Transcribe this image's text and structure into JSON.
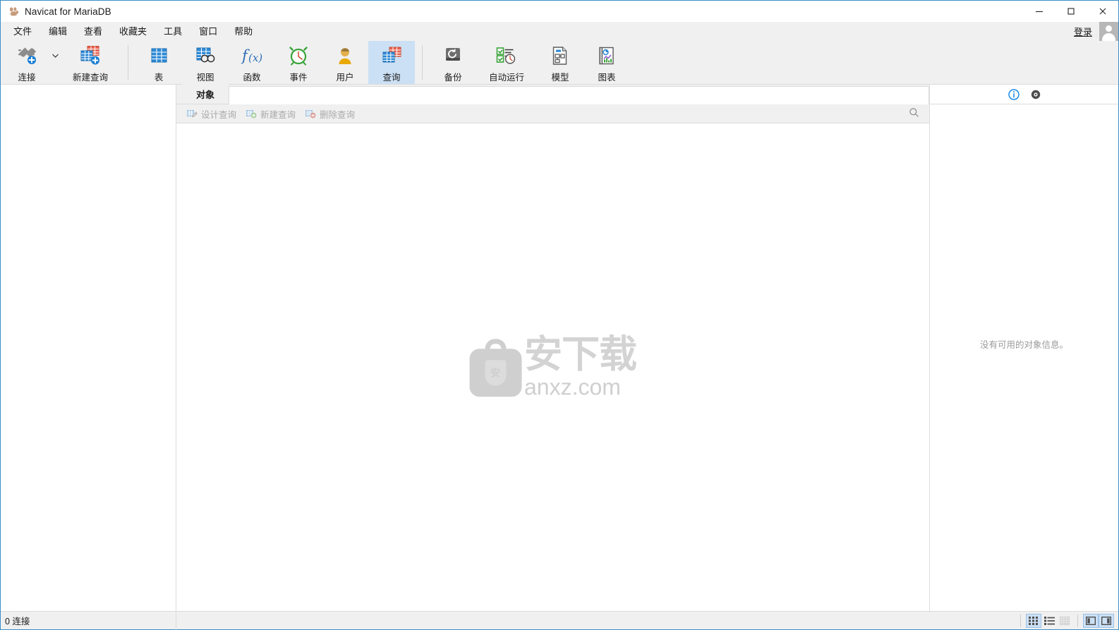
{
  "window": {
    "title": "Navicat for MariaDB",
    "logo_icon": "navicat-paw-logo",
    "minimize_label": "—",
    "maximize_label": "□",
    "close_label": "✕"
  },
  "menubar": {
    "items": [
      {
        "label": "文件"
      },
      {
        "label": "编辑"
      },
      {
        "label": "查看"
      },
      {
        "label": "收藏夹"
      },
      {
        "label": "工具"
      },
      {
        "label": "窗口"
      },
      {
        "label": "帮助"
      }
    ],
    "login_label": "登录",
    "avatar_icon": "user-avatar-icon"
  },
  "toolbar": {
    "items": [
      {
        "label": "连接",
        "icon": "connection-plug-add-icon",
        "active": false,
        "has_caret": true
      },
      {
        "label": "新建查询",
        "icon": "new-query-add-icon",
        "active": false,
        "has_caret": false
      },
      {
        "label": "表",
        "icon": "table-grid-icon",
        "active": false,
        "has_caret": false
      },
      {
        "label": "视图",
        "icon": "view-icon",
        "active": false,
        "has_caret": false
      },
      {
        "label": "函数",
        "icon": "function-fx-icon",
        "active": false,
        "has_caret": false
      },
      {
        "label": "事件",
        "icon": "event-clock-icon",
        "active": false,
        "has_caret": false
      },
      {
        "label": "用户",
        "icon": "user-person-icon",
        "active": false,
        "has_caret": false
      },
      {
        "label": "查询",
        "icon": "query-tables-icon",
        "active": true,
        "has_caret": false
      },
      {
        "label": "备份",
        "icon": "backup-restore-icon",
        "active": false,
        "has_caret": false
      },
      {
        "label": "自动运行",
        "icon": "automation-schedule-icon",
        "active": false,
        "has_caret": false
      },
      {
        "label": "模型",
        "icon": "model-diagram-icon",
        "active": false,
        "has_caret": false
      },
      {
        "label": "图表",
        "icon": "chart-report-icon",
        "active": false,
        "has_caret": false
      }
    ]
  },
  "tabs": {
    "items": [
      {
        "label": "对象",
        "active": true
      }
    ]
  },
  "subtoolbar": {
    "buttons": [
      {
        "label": "设计查询",
        "icon": "design-query-icon",
        "enabled": false
      },
      {
        "label": "新建查询",
        "icon": "new-query-icon",
        "enabled": false
      },
      {
        "label": "删除查询",
        "icon": "delete-query-icon",
        "enabled": false
      }
    ],
    "search_icon": "search-icon"
  },
  "canvas": {
    "watermark": {
      "badge_glyph": "安",
      "cn_text": "安下载",
      "url_text": "anxz.com"
    }
  },
  "right_panel": {
    "header_icons": [
      {
        "name": "info-icon",
        "color": "#1e8ae6"
      },
      {
        "name": "target-eye-icon",
        "color": "#4d4d4d"
      }
    ],
    "empty_message": "没有可用的对象信息。"
  },
  "statusbar": {
    "connections_text": "0 连接",
    "view_buttons": [
      {
        "name": "grid-view-icon",
        "selected": true,
        "enabled": true
      },
      {
        "name": "list-view-icon",
        "selected": false,
        "enabled": true
      },
      {
        "name": "detail-view-icon",
        "selected": false,
        "enabled": false
      }
    ],
    "panel_buttons": [
      {
        "name": "toggle-left-panel-icon",
        "selected": true,
        "enabled": true
      },
      {
        "name": "toggle-right-panel-icon",
        "selected": true,
        "enabled": true
      }
    ]
  },
  "colors": {
    "accent": "#3a8ec8",
    "active_tool_bg": "#cce0f5",
    "chrome_bg": "#f0f0f0",
    "border": "#dcdcdc",
    "muted_text": "#9a9a9a"
  }
}
